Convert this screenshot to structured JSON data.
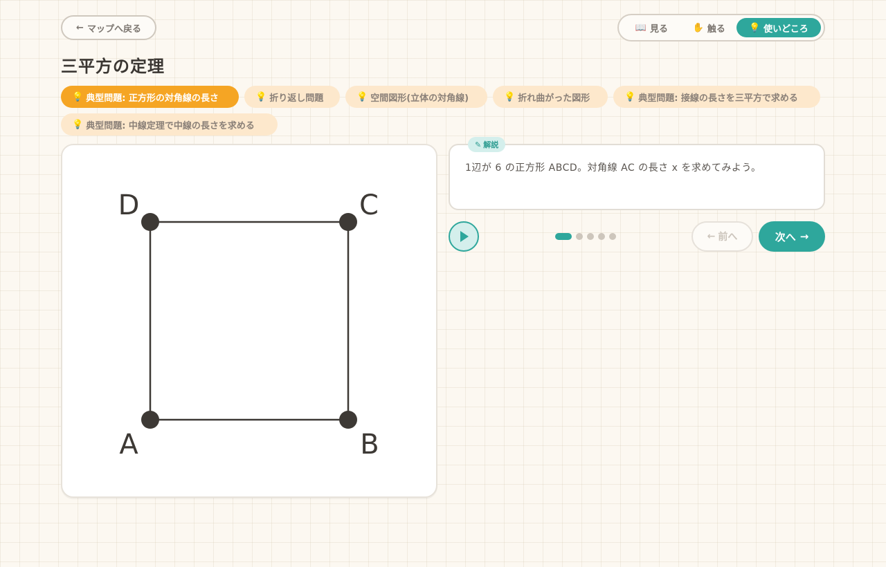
{
  "nav": {
    "back_arrow": "←",
    "back_label": "マップへ戻る"
  },
  "modes": [
    {
      "icon": "📖",
      "icon_name": "book-icon",
      "label": "見る",
      "active": false
    },
    {
      "icon": "✋",
      "icon_name": "hand-icon",
      "label": "触る",
      "active": false
    },
    {
      "icon": "💡",
      "icon_name": "lightbulb-icon",
      "label": "使いどころ",
      "active": true
    }
  ],
  "title": "三平方の定理",
  "chips": [
    {
      "label": "典型問題: 正方形の対角線の長さ",
      "active": true
    },
    {
      "label": "折り返し問題",
      "active": false
    },
    {
      "label": "空間図形(立体の対角線)",
      "active": false
    },
    {
      "label": "折れ曲がった図形",
      "active": false
    },
    {
      "label": "典型問題: 接線の長さを三平方で求める",
      "active": false
    },
    {
      "label": "典型問題: 中線定理で中線の長さを求める",
      "active": false
    }
  ],
  "chip_icon": "💡",
  "figure": {
    "points": [
      {
        "name": "A",
        "label": "A"
      },
      {
        "name": "B",
        "label": "B"
      },
      {
        "name": "C",
        "label": "C"
      },
      {
        "name": "D",
        "label": "D"
      }
    ]
  },
  "explanation": {
    "tag_icon": "✎",
    "tag_label": "解説",
    "text": "1辺が 6 の正方形 ABCD。対角線 AC の長さ x を求めてみよう。"
  },
  "steps": {
    "total": 5,
    "current": 1
  },
  "controls": {
    "prev_arrow": "←",
    "prev_label": "前へ",
    "next_label": "次へ",
    "next_arrow": "→"
  },
  "colors": {
    "accent": "#2ea79c",
    "chip_active": "#f5a524",
    "chip_inactive": "#fde8cc",
    "figure_line": "#3d3935"
  }
}
